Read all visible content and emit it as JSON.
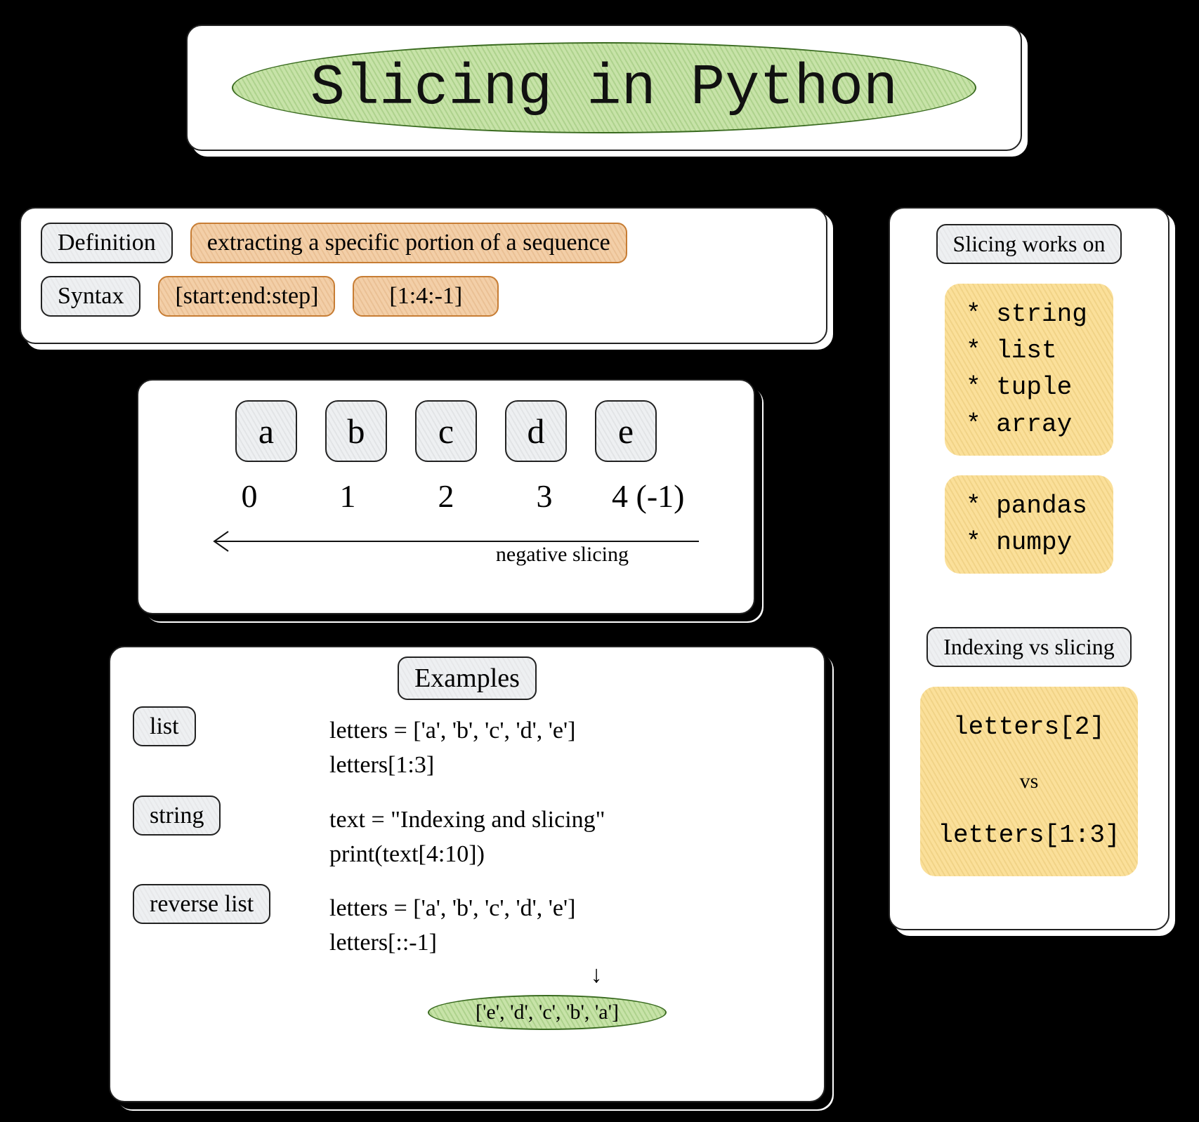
{
  "title": "Slicing in Python",
  "definition": {
    "label": "Definition",
    "text": "extracting a specific portion of a sequence"
  },
  "syntax": {
    "label": "Syntax",
    "pattern": "[start:end:step]",
    "example": "[1:4:-1]"
  },
  "letters": {
    "items": [
      "a",
      "b",
      "c",
      "d",
      "e"
    ],
    "indices": [
      "0",
      "1",
      "2",
      "3",
      "4 (-1)"
    ],
    "negative_label": "negative slicing"
  },
  "examples": {
    "title": "Examples",
    "list": {
      "label": "list",
      "line1": "letters = ['a', 'b', 'c', 'd', 'e']",
      "line2": "letters[1:3]"
    },
    "string": {
      "label": "string",
      "line1": "text = \"Indexing and slicing\"",
      "line2": "print(text[4:10])"
    },
    "reverse": {
      "label": "reverse list",
      "line1": "letters = ['a', 'b', 'c', 'd', 'e']",
      "line2": "letters[::-1]",
      "result": "['e', 'd', 'c', 'b', 'a']"
    }
  },
  "sidebar": {
    "works_on_label": "Slicing works on",
    "group1": [
      "* string",
      "* list",
      "* tuple",
      "* array"
    ],
    "group2": [
      "* pandas",
      "* numpy"
    ],
    "compare_label": "Indexing vs slicing",
    "compare_a": "letters[2]",
    "compare_vs": "vs",
    "compare_b": "letters[1:3]"
  }
}
